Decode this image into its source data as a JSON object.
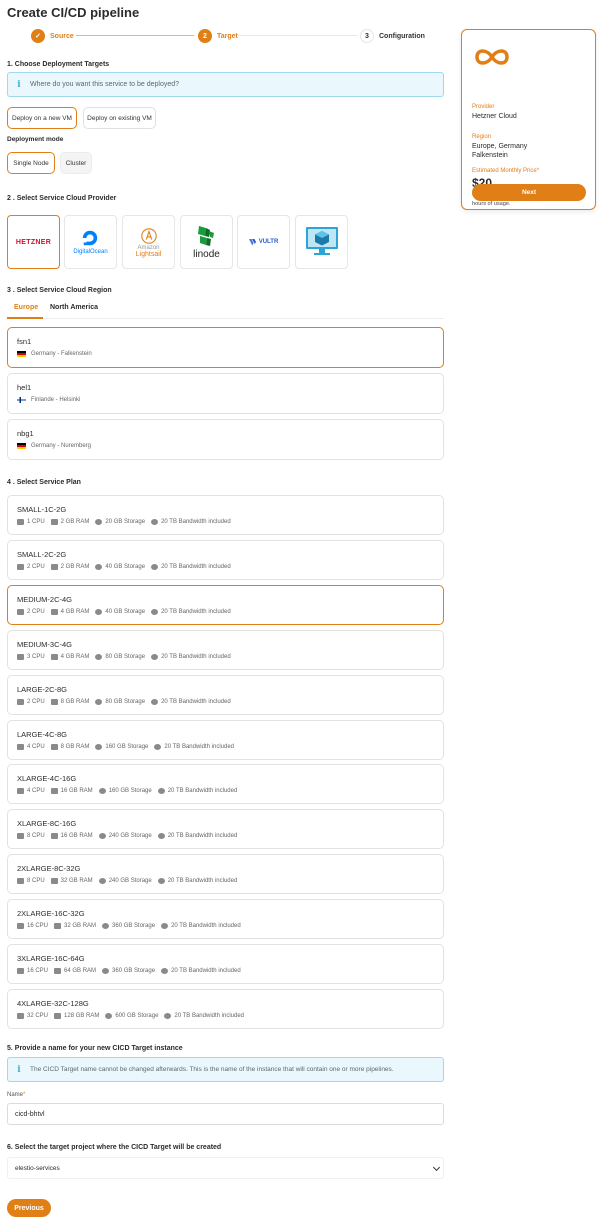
{
  "page": {
    "title": "Create CI/CD pipeline"
  },
  "stepper": {
    "steps": [
      {
        "number": "✓",
        "label": "Source",
        "state": "done"
      },
      {
        "number": "2",
        "label": "Target",
        "state": "active"
      },
      {
        "number": "3",
        "label": "Configuration",
        "state": "todo"
      }
    ]
  },
  "deployment": {
    "heading": "1. Choose Deployment Targets",
    "info": "Where do you want this service to be deployed?",
    "options": [
      "Deploy on a new VM",
      "Deploy on existing VM"
    ],
    "selected_option": "Deploy on a new VM",
    "mode_heading": "Deployment mode",
    "modes": [
      "Single Node",
      "Cluster"
    ],
    "selected_mode": "Single Node"
  },
  "providers": {
    "heading": "2 . Select Service Cloud Provider",
    "items": [
      {
        "name": "Hetzner",
        "logo_text": "HETZNER",
        "icon": "hetzner-logo",
        "selected": true
      },
      {
        "name": "DigitalOcean",
        "logo_text": "DigitalOcean",
        "icon": "digitalocean-logo",
        "selected": false
      },
      {
        "name": "Amazon Lightsail",
        "logo_text": "Amazon",
        "logo_text2": "Lightsail",
        "icon": "lightsail-logo",
        "selected": false
      },
      {
        "name": "Linode",
        "logo_text": "linode",
        "icon": "linode-logo",
        "selected": false
      },
      {
        "name": "Vultr",
        "logo_text": "VULTR",
        "icon": "vultr-logo",
        "selected": false
      },
      {
        "name": "Custom VM",
        "logo_text": "",
        "icon": "monitor-cube-logo",
        "selected": false
      }
    ]
  },
  "region": {
    "heading": "3 . Select Service Cloud Region",
    "tabs": [
      "Europe",
      "North America"
    ],
    "active_tab": "Europe",
    "items": [
      {
        "code": "fsn1",
        "location": "Germany - Falkenstein",
        "flag": "germany-flag",
        "selected": true
      },
      {
        "code": "hel1",
        "location": "Finlande - Helsinki",
        "flag": "finland-flag",
        "selected": false
      },
      {
        "code": "nbg1",
        "location": "Germany - Nuremberg",
        "flag": "germany-flag",
        "selected": false
      }
    ]
  },
  "plan": {
    "heading": "4 . Select Service Plan",
    "items": [
      {
        "name": "SMALL-1C-2G",
        "cpu": "1 CPU",
        "ram": "2 GB RAM",
        "storage": "20 GB Storage",
        "bandwidth": "20 TB Bandwidth included",
        "selected": false
      },
      {
        "name": "SMALL-2C-2G",
        "cpu": "2 CPU",
        "ram": "2 GB RAM",
        "storage": "40 GB Storage",
        "bandwidth": "20 TB Bandwidth included",
        "selected": false
      },
      {
        "name": "MEDIUM-2C-4G",
        "cpu": "2 CPU",
        "ram": "4 GB RAM",
        "storage": "40 GB Storage",
        "bandwidth": "20 TB Bandwidth included",
        "selected": true
      },
      {
        "name": "MEDIUM-3C-4G",
        "cpu": "3 CPU",
        "ram": "4 GB RAM",
        "storage": "80 GB Storage",
        "bandwidth": "20 TB Bandwidth included",
        "selected": false
      },
      {
        "name": "LARGE-2C-8G",
        "cpu": "2 CPU",
        "ram": "8 GB RAM",
        "storage": "80 GB Storage",
        "bandwidth": "20 TB Bandwidth included",
        "selected": false
      },
      {
        "name": "LARGE-4C-8G",
        "cpu": "4 CPU",
        "ram": "8 GB RAM",
        "storage": "160 GB Storage",
        "bandwidth": "20 TB Bandwidth included",
        "selected": false
      },
      {
        "name": "XLARGE-4C-16G",
        "cpu": "4 CPU",
        "ram": "16 GB RAM",
        "storage": "160 GB Storage",
        "bandwidth": "20 TB Bandwidth included",
        "selected": false
      },
      {
        "name": "XLARGE-8C-16G",
        "cpu": "8 CPU",
        "ram": "16 GB RAM",
        "storage": "240 GB Storage",
        "bandwidth": "20 TB Bandwidth included",
        "selected": false
      },
      {
        "name": "2XLARGE-8C-32G",
        "cpu": "8 CPU",
        "ram": "32 GB RAM",
        "storage": "240 GB Storage",
        "bandwidth": "20 TB Bandwidth included",
        "selected": false
      },
      {
        "name": "2XLARGE-16C-32G",
        "cpu": "16 CPU",
        "ram": "32 GB RAM",
        "storage": "360 GB Storage",
        "bandwidth": "20 TB Bandwidth included",
        "selected": false
      },
      {
        "name": "3XLARGE-16C-64G",
        "cpu": "16 CPU",
        "ram": "64 GB RAM",
        "storage": "360 GB Storage",
        "bandwidth": "20 TB Bandwidth included",
        "selected": false
      },
      {
        "name": "4XLARGE-32C-128G",
        "cpu": "32 CPU",
        "ram": "128 GB RAM",
        "storage": "600 GB Storage",
        "bandwidth": "20 TB Bandwidth included",
        "selected": false
      }
    ]
  },
  "instance_name": {
    "heading": "5. Provide a name for your new CICD Target instance",
    "info": "The CICD Target name cannot be changed afterwards. This is the name of the instance that will contain one or more pipelines.",
    "label": "Name",
    "required_mark": "*",
    "value": "cicd-bhtvl"
  },
  "project": {
    "heading": "6. Select the target project where the CICD Target will be created",
    "selected": "elestio-services"
  },
  "actions": {
    "previous": "Previous",
    "next": "Next"
  },
  "summary": {
    "provider_label": "Provider",
    "provider_value": "Hetzner Cloud",
    "region_label": "Region",
    "region_value": "Europe, Germany Falkenstein",
    "price_label": "Estimated Monthly Price*",
    "price_value": "$20",
    "note": "*Estimated monthly price is based on 730 hours of usage."
  },
  "colors": {
    "accent": "#e07f16",
    "info_bg": "#eaf7fc",
    "info_border": "#9fd9ee"
  }
}
